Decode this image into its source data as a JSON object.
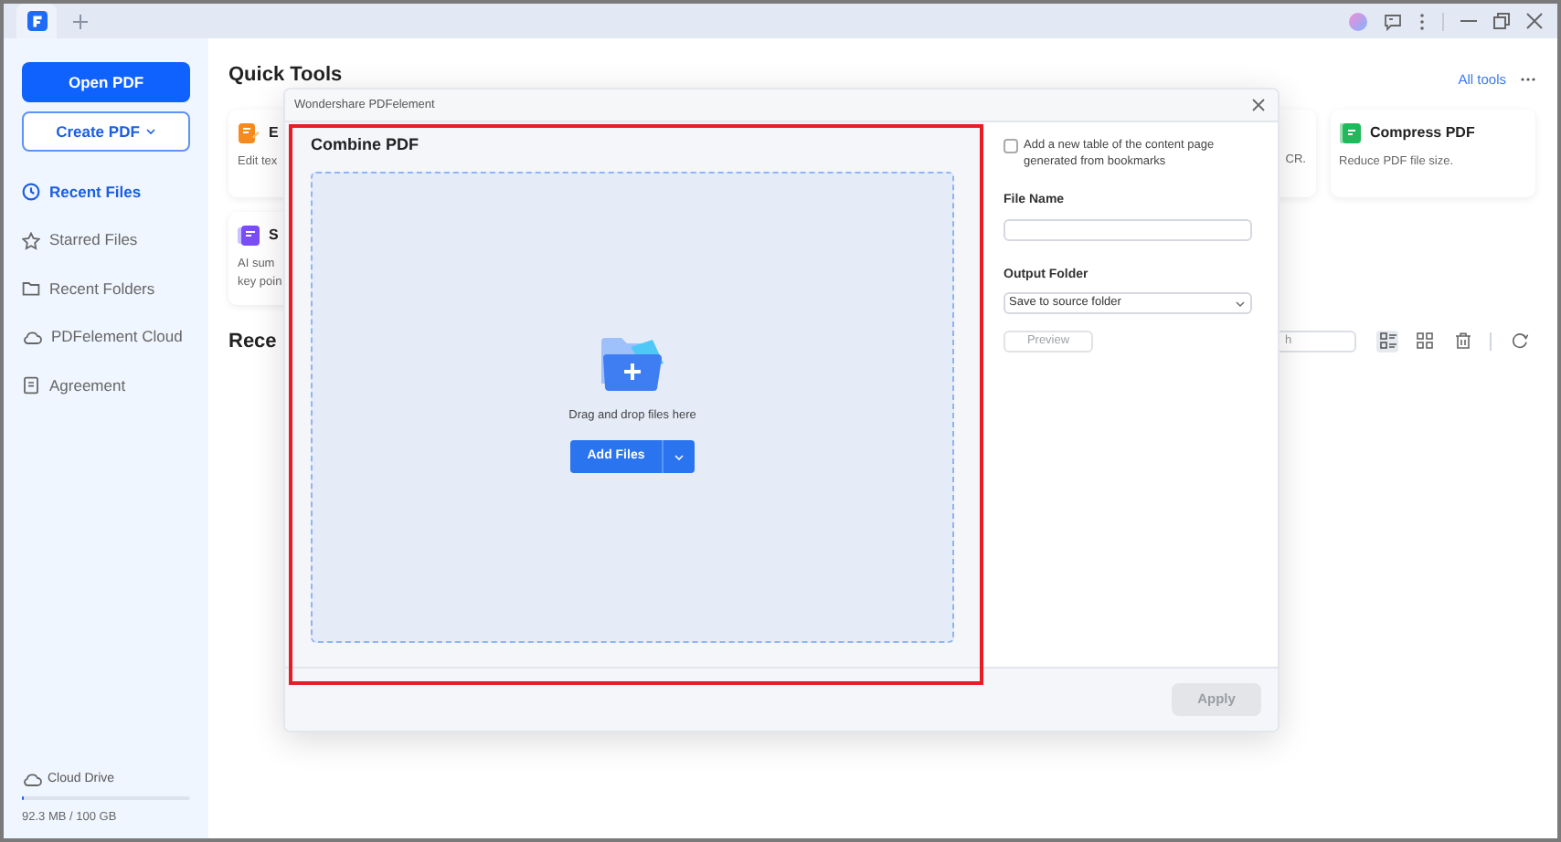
{
  "sidebar": {
    "open_button": "Open PDF",
    "create_button": "Create PDF",
    "items": [
      {
        "label": "Recent Files",
        "selected": true
      },
      {
        "label": "Starred Files",
        "selected": false
      },
      {
        "label": "Recent Folders",
        "selected": false
      },
      {
        "label": "PDFelement Cloud",
        "selected": false
      },
      {
        "label": "Agreement",
        "selected": false
      }
    ],
    "cloud_drive": {
      "label": "Cloud Drive",
      "level": 0.001,
      "usage": "92.3 MB / 100 GB"
    }
  },
  "quick_tools": {
    "title": "Quick Tools",
    "all_tools": "All tools",
    "cards": [
      {
        "kind": "edit",
        "title": "E",
        "description": [
          "Edit tex"
        ]
      },
      {
        "kind": "ocr",
        "description": [
          "CR."
        ]
      },
      {
        "kind": "compress",
        "title": "Compress PDF",
        "description": [
          "Reduce PDF file size."
        ]
      },
      {
        "kind": "summarize",
        "title": "S",
        "description": [
          "AI sum",
          "key poin"
        ]
      }
    ]
  },
  "recent": {
    "title": "Rece",
    "search_placeholder": "h"
  },
  "dialog": {
    "title": "Wondershare PDFelement",
    "heading": "Combine PDF",
    "drop_hint": "Drag and drop files here",
    "add_button": "Add Files",
    "toc_option": {
      "label": "Add a new table of the content page generated from bookmarks",
      "checked": false
    },
    "file_name": {
      "label": "File Name"
    },
    "output_folder": {
      "label": "Output Folder",
      "value": "Save to source folder"
    },
    "preview_button": {
      "label": "Preview",
      "disabled": true
    },
    "apply_button": {
      "label": "Apply",
      "disabled": true
    }
  }
}
